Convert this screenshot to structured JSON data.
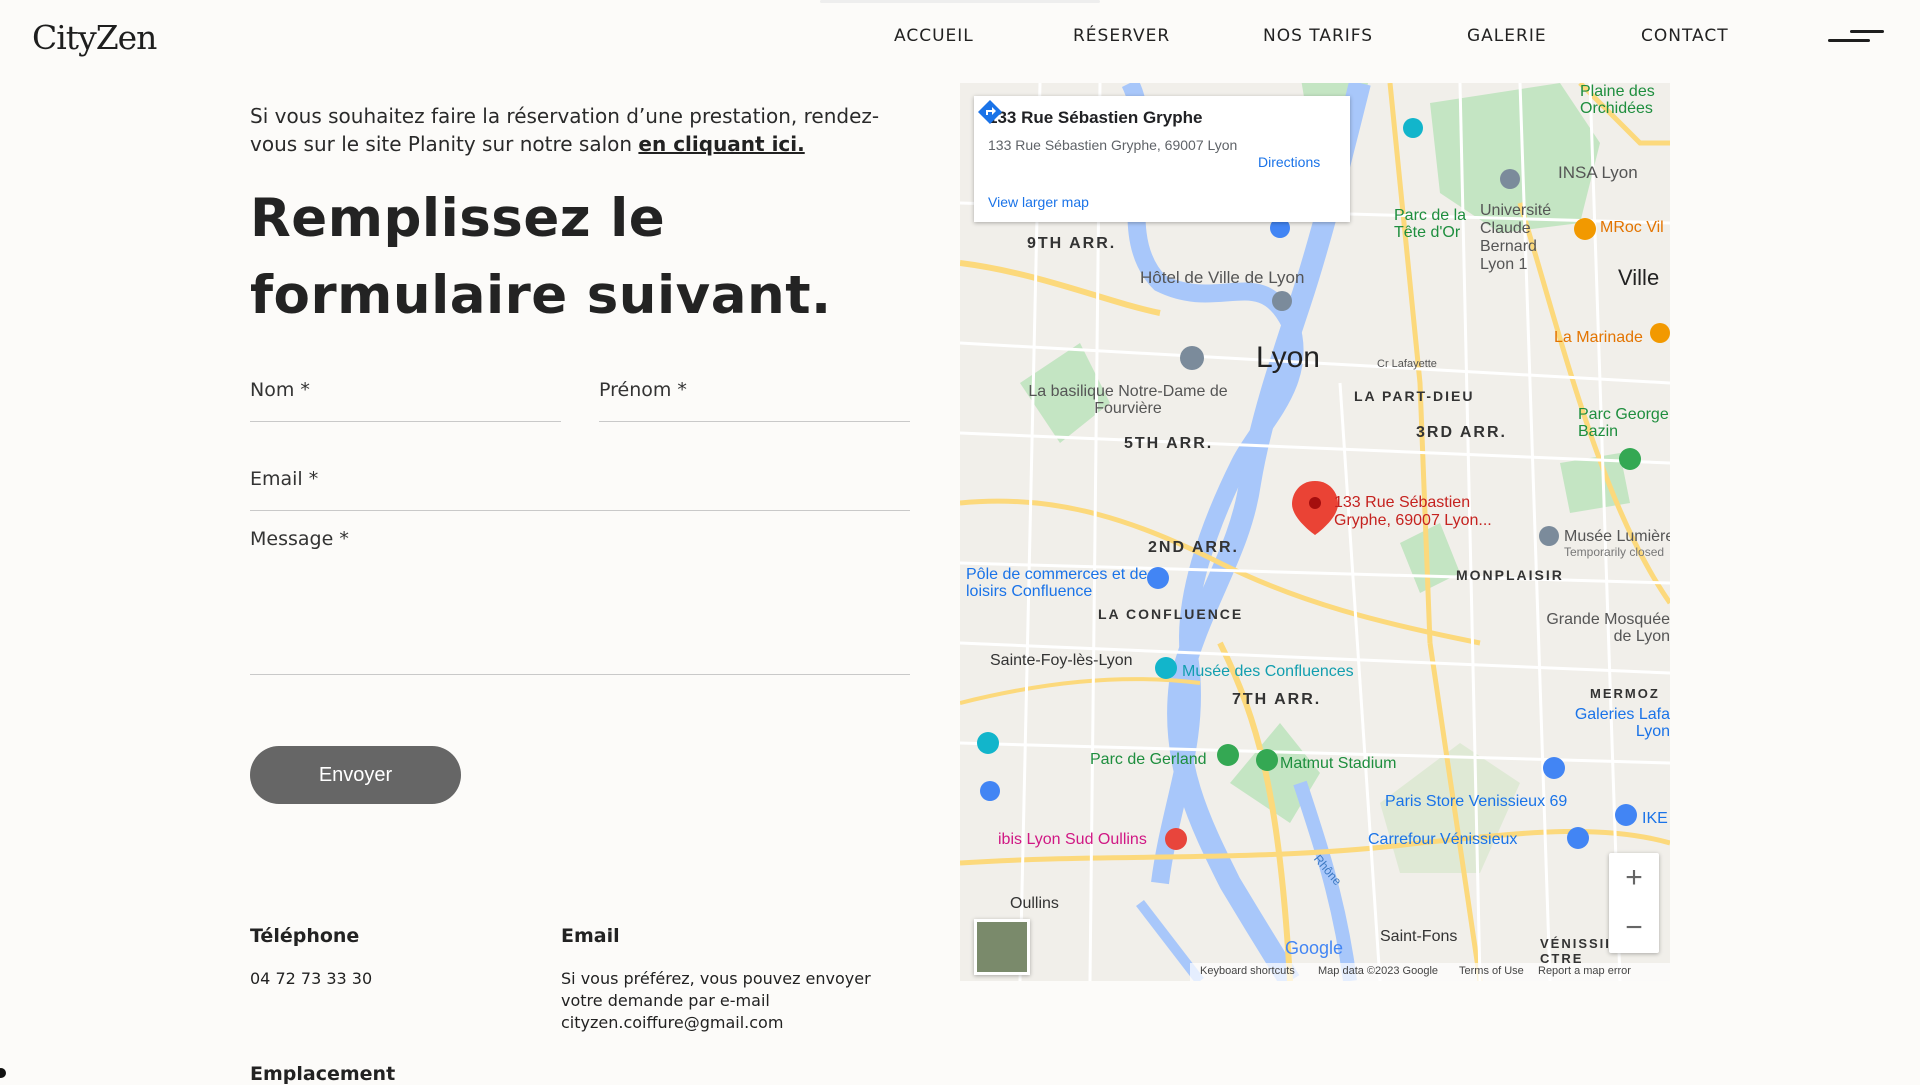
{
  "header": {
    "logo": "CityZen",
    "nav": [
      "ACCUEIL",
      "RÉSERVER",
      "NOS TARIFS",
      "GALERIE",
      "CONTACT"
    ]
  },
  "intro": {
    "text": "Si vous souhaitez faire la réservation d’une prestation, rendez-vous sur le site Planity sur notre salon ",
    "link": "en cliquant ici."
  },
  "form": {
    "title": "Remplissez le formulaire suivant.",
    "nom_label": "Nom *",
    "prenom_label": "Prénom *",
    "email_label": "Email *",
    "message_label": "Message *",
    "submit": "Envoyer"
  },
  "contact": {
    "phone_heading": "Téléphone",
    "phone": "04 72 73 33 30",
    "email_heading": "Email",
    "email_text": "Si vous préférez, vous pouvez envoyer votre demande par e-mail cityzen.coiffure@gmail.com",
    "location_heading": "Emplacement"
  },
  "map": {
    "card_title": "133 Rue Sébastien Gryphe",
    "card_address": "133 Rue Sébastien Gryphe, 69007 Lyon",
    "card_link": "View larger map",
    "directions": "Directions",
    "pin_label": "133 Rue Sébastien Gryphe, 69007 Lyon...",
    "labels": {
      "city": "Lyon",
      "arr9": "9TH ARR.",
      "arr5": "5TH ARR.",
      "arr2": "2ND ARR.",
      "arr3": "3RD ARR.",
      "arr7": "7TH ARR.",
      "partdieu": "LA PART-DIEU",
      "confluence": "LA CONFLUENCE",
      "monplaisir": "MONPLAISIR",
      "mermoz": "MERMOZ",
      "hotelville": "Hôtel de Ville de Lyon",
      "basilique": "La basilique Notre-Dame de Fourvière",
      "insa": "INSA Lyon",
      "univ": "Université Claude Bernard Lyon 1",
      "parctete": "Parc de la Tête d'Or",
      "plaine": "Plaine des Orchidées",
      "mroc": "MRoc Vil",
      "ville": "Ville",
      "marinade": "La Marinade",
      "parcgeorge": "Parc George Bazin",
      "musee_lumiere": "Musée Lumière",
      "temp_closed": "Temporarily closed",
      "pole": "Pôle de commerces et de loisirs Confluence",
      "saintefoy": "Sainte-Foy-lès-Lyon",
      "musee_conf": "Musée des Confluences",
      "mosquee": "Grande Mosquée de Lyon",
      "galeries": "Galeries Lafa Lyon",
      "gerland": "Parc de Gerland",
      "matmut": "Matmut Stadium",
      "paris_store": "Paris Store Venissieux 69",
      "carrefour": "Carrefour Vénissieux",
      "ibis": "ibis Lyon Sud Oullins",
      "oullins": "Oullins",
      "saintfons": "Saint-Fons",
      "venissieux": "VÉNISSII CTRE",
      "lafayette": "Cr Lafayette",
      "rhone": "Rhône",
      "ikea": "IKE"
    },
    "footer": {
      "shortcuts": "Keyboard shortcuts",
      "mapdata": "Map data ©2023 Google",
      "terms": "Terms of Use",
      "report": "Report a map error"
    },
    "google": "Google",
    "zoom_in": "+",
    "zoom_out": "−",
    "colors": {
      "water": "#a8c7fa",
      "park": "#c4e5c3",
      "road_major": "#fcd97c",
      "road_minor": "#ffffff",
      "pin": "#ea4335",
      "poi_blue": "#4285f4",
      "poi_teal": "#12b5cb"
    }
  }
}
